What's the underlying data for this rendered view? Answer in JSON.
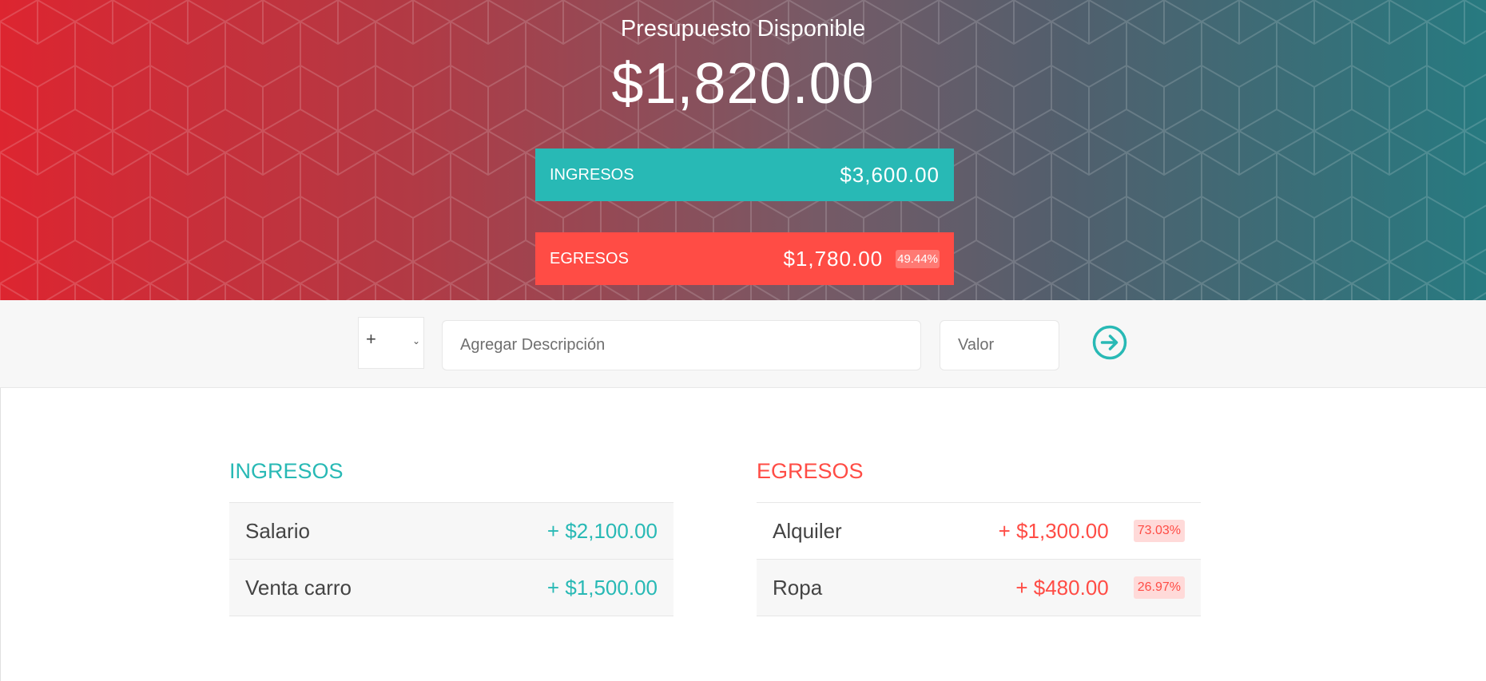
{
  "budget": {
    "title": "Presupuesto Disponible",
    "value": "$1,820.00"
  },
  "summary": {
    "income": {
      "label": "INGRESOS",
      "amount": "$3,600.00"
    },
    "expense": {
      "label": "EGRESOS",
      "amount": "$1,780.00",
      "percentage": "49.44%"
    }
  },
  "add_form": {
    "type_value": "+",
    "description_placeholder": "Agregar Descripción",
    "value_placeholder": "Valor",
    "submit_icon": "arrow-right-circle-icon"
  },
  "income_list": {
    "title": "INGRESOS",
    "items": [
      {
        "description": "Salario",
        "value": "+ $2,100.00"
      },
      {
        "description": "Venta carro",
        "value": "+ $1,500.00"
      }
    ]
  },
  "expense_list": {
    "title": "EGRESOS",
    "items": [
      {
        "description": "Alquiler",
        "value": "+ $1,300.00",
        "percentage": "73.03%"
      },
      {
        "description": "Ropa",
        "value": "+ $480.00",
        "percentage": "26.97%"
      }
    ]
  },
  "colors": {
    "income": "#28b9b5",
    "expense": "#ff4c45",
    "gradient_start": "#dd2530",
    "gradient_end": "#277a80"
  }
}
